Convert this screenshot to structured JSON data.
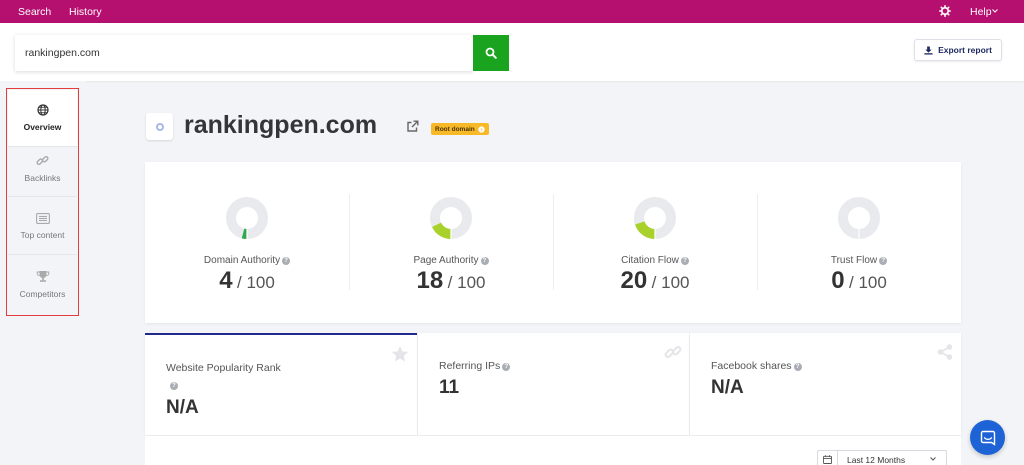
{
  "topbar": {
    "nav": [
      "Search",
      "History"
    ],
    "settings_icon": "gear-icon",
    "help_label": "Help",
    "bg_color": "#b5106f"
  },
  "search": {
    "value": "rankingpen.com",
    "button_icon": "search-icon",
    "button_color": "#1aa31f"
  },
  "export": {
    "label": "Export report",
    "icon": "download-icon"
  },
  "sidebar": {
    "items": [
      {
        "label": "Overview",
        "icon": "globe-icon",
        "active": true
      },
      {
        "label": "Backlinks",
        "icon": "link-icon",
        "active": false
      },
      {
        "label": "Top content",
        "icon": "list-icon",
        "active": false
      },
      {
        "label": "Competitors",
        "icon": "trophy-icon",
        "active": false
      }
    ]
  },
  "header": {
    "domain": "rankingpen.com",
    "badge": "Root domain",
    "badge_color": "#f7b928"
  },
  "metrics": [
    {
      "label": "Domain Authority",
      "value": "4",
      "max": "/ 100",
      "fraction": 0.04,
      "color": "#2fa84f"
    },
    {
      "label": "Page Authority",
      "value": "18",
      "max": "/ 100",
      "fraction": 0.18,
      "color": "#a8d22b"
    },
    {
      "label": "Citation Flow",
      "value": "20",
      "max": "/ 100",
      "fraction": 0.2,
      "color": "#a8d22b"
    },
    {
      "label": "Trust Flow",
      "value": "0",
      "max": "/ 100",
      "fraction": 0.0,
      "color": "#a8d22b"
    }
  ],
  "stats": [
    {
      "label": "Website Popularity Rank",
      "value": "N/A",
      "icon": "star-icon"
    },
    {
      "label": "Referring IPs",
      "value": "11",
      "icon": "link-icon"
    },
    {
      "label": "Facebook shares",
      "value": "N/A",
      "icon": "share-icon"
    }
  ],
  "period": {
    "label": "Last 12 Months",
    "icon": "calendar-icon"
  },
  "chat": {
    "icon": "chat-icon",
    "color": "#1e63d6"
  }
}
